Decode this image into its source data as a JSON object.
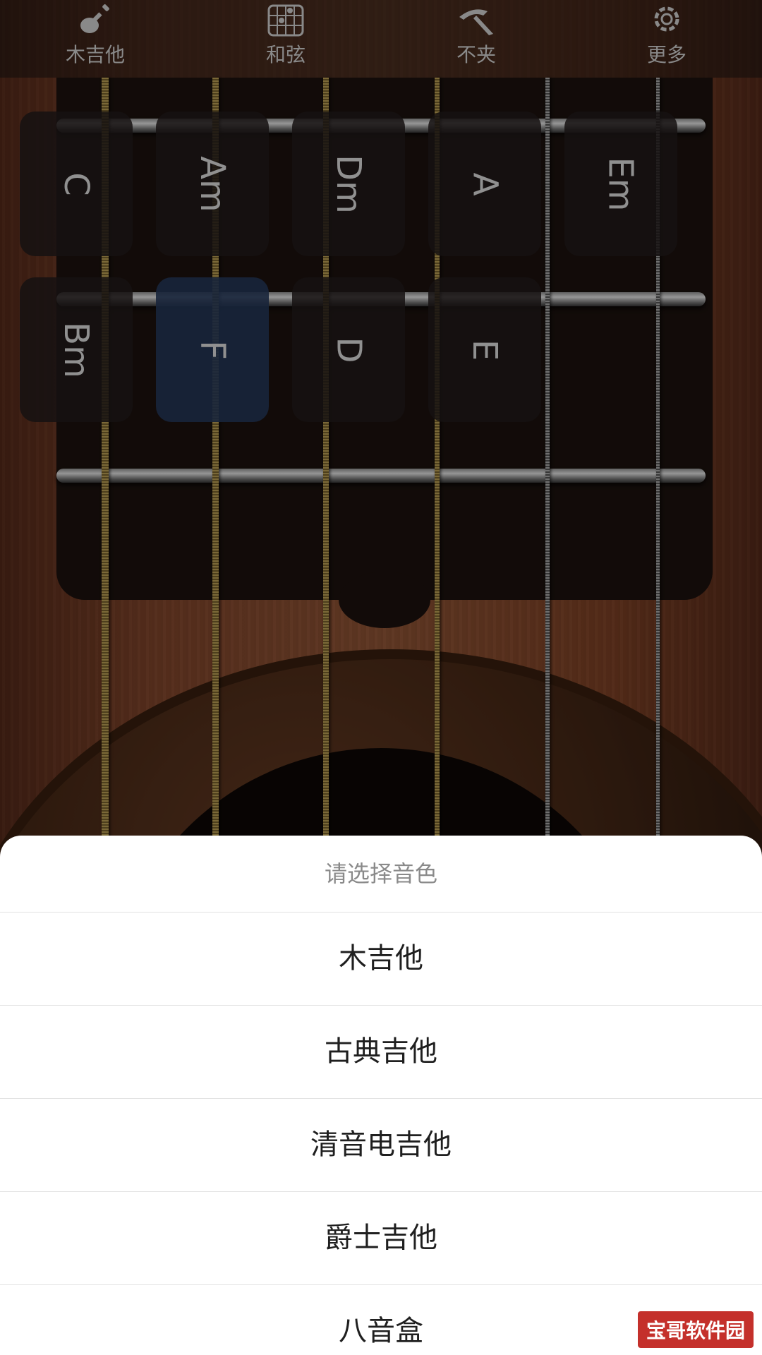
{
  "toolbar": {
    "items": [
      {
        "label": "木吉他",
        "icon": "guitar-icon"
      },
      {
        "label": "和弦",
        "icon": "chord-grid-icon"
      },
      {
        "label": "不夹",
        "icon": "capo-icon"
      },
      {
        "label": "更多",
        "icon": "gear-icon"
      }
    ]
  },
  "chords": {
    "row1": [
      "C",
      "Am",
      "Dm",
      "A",
      "Em"
    ],
    "row2": [
      "Bm",
      "F",
      "D",
      "E"
    ],
    "active": "F"
  },
  "sheet": {
    "title": "请选择音色",
    "options": [
      "木吉他",
      "古典吉他",
      "清音电吉他",
      "爵士吉他",
      "八音盒"
    ]
  },
  "watermark": "宝哥软件园",
  "colors": {
    "active_chord": "#283c5f",
    "sheet_background": "#ffffff",
    "title_text": "#8a8a8a"
  }
}
